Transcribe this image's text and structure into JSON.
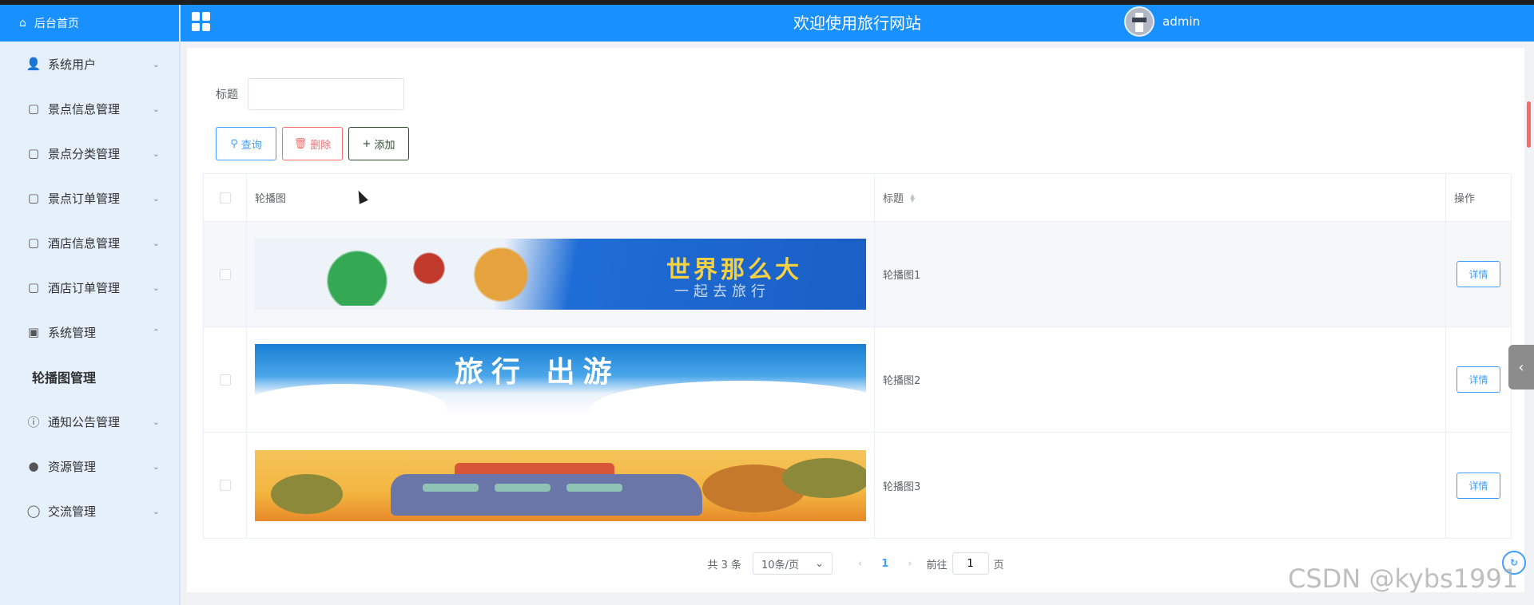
{
  "header": {
    "home_label": "后台首页",
    "site_title": "欢迎使用旅行网站",
    "user_name": "admin"
  },
  "sidebar": {
    "items": [
      {
        "label": "系统用户",
        "icon": "user-icon",
        "expanded": false
      },
      {
        "label": "景点信息管理",
        "icon": "doc-icon",
        "expanded": false
      },
      {
        "label": "景点分类管理",
        "icon": "doc-icon",
        "expanded": false
      },
      {
        "label": "景点订单管理",
        "icon": "doc-icon",
        "expanded": false
      },
      {
        "label": "酒店信息管理",
        "icon": "doc-icon",
        "expanded": false
      },
      {
        "label": "酒店订单管理",
        "icon": "doc-icon",
        "expanded": false
      },
      {
        "label": "系统管理",
        "icon": "picture-icon",
        "expanded": true
      },
      {
        "label": "轮播图管理",
        "icon": "",
        "sub": true,
        "active": true
      },
      {
        "label": "通知公告管理",
        "icon": "info-icon",
        "expanded": false
      },
      {
        "label": "资源管理",
        "icon": "bulb-icon",
        "expanded": false
      },
      {
        "label": "交流管理",
        "icon": "chat-icon",
        "expanded": false
      }
    ]
  },
  "search": {
    "title_label": "标题",
    "title_value": "",
    "query_label": "查询",
    "delete_label": "删除",
    "add_label": "添加"
  },
  "table": {
    "columns": [
      "轮播图",
      "标题",
      "操作"
    ],
    "rows": [
      {
        "title": "轮播图1",
        "banner_text": "世界那么大",
        "banner_sub": "一起去旅行",
        "action": "详情"
      },
      {
        "title": "轮播图2",
        "banner_text": "旅行  出游",
        "banner_sub": "",
        "action": "详情"
      },
      {
        "title": "轮播图3",
        "banner_text": "",
        "banner_sub": "",
        "action": "详情"
      }
    ]
  },
  "pagination": {
    "total_text": "共 3 条",
    "page_size": "10条/页",
    "current_page": "1",
    "goto_prefix": "前往",
    "goto_value": "1",
    "goto_suffix": "页"
  },
  "watermark": "CSDN @kybs1991",
  "colors": {
    "primary": "#1890ff",
    "sidebar_bg": "#e6f0fb",
    "danger": "#f56c6c",
    "link": "#409eff"
  }
}
